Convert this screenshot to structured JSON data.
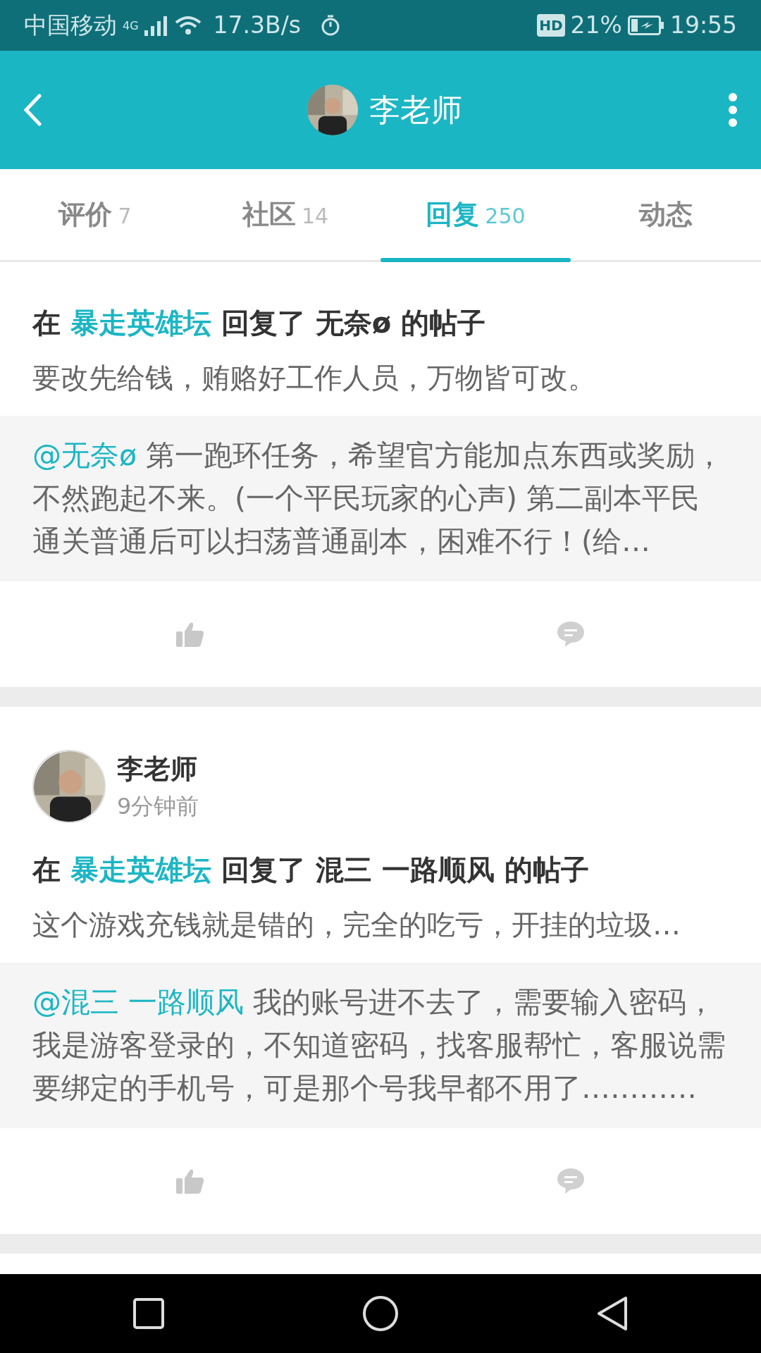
{
  "status_bar": {
    "carrier": "中国移动",
    "network": "4G",
    "speed": "17.3B/s",
    "hd": "HD",
    "battery": "21%",
    "time": "19:55"
  },
  "header": {
    "title": "李老师"
  },
  "tabs": [
    {
      "label": "评价",
      "count": "7",
      "selected": false
    },
    {
      "label": "社区",
      "count": "14",
      "selected": false
    },
    {
      "label": "回复",
      "count": "250",
      "selected": true
    },
    {
      "label": "动态",
      "selected": false
    }
  ],
  "posts": [
    {
      "prefix": "在",
      "forum": "暴走英雄坛",
      "action": "回复了 无奈ø 的帖子",
      "content": "要改先给钱，贿赂好工作人员，万物皆可改。",
      "quote_mention": "@无奈ø",
      "quote_text": "第一跑环任务，希望官方能加点东西或奖励，不然跑起不来。(一个平民玩家的心声) 第二副本平民通关普通后可以扫荡普通副本，困难不行！(给…"
    },
    {
      "author": "李老师",
      "time": "9分钟前",
      "prefix": "在",
      "forum": "暴走英雄坛",
      "action": "回复了 混三 一路顺风 的帖子",
      "content": "这个游戏充钱就是错的，完全的吃亏，开挂的垃圾…",
      "quote_mention": "@混三 一路顺风",
      "quote_text": "我的账号进不去了，需要输入密码，我是游客登录的，不知道密码，找客服帮忙，客服说需要绑定的手机号，可是那个号我早都不用了…………"
    }
  ]
}
